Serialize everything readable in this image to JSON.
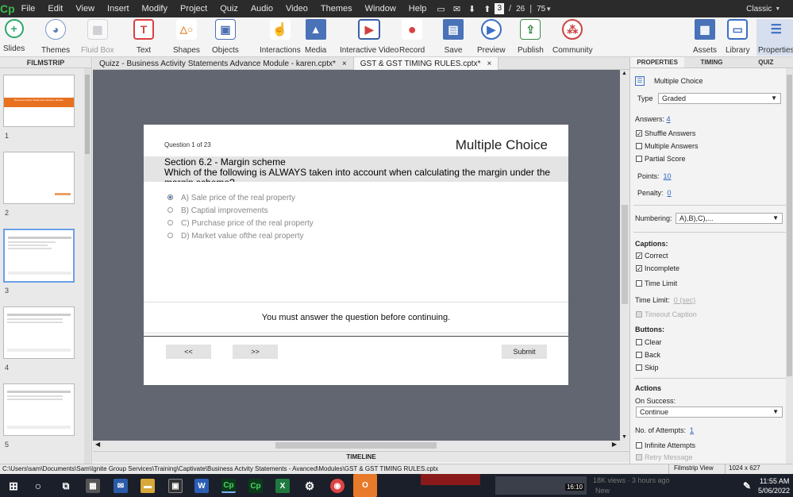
{
  "menubar": {
    "logo": "Cp",
    "items": [
      "File",
      "Edit",
      "View",
      "Insert",
      "Modify",
      "Project",
      "Quiz",
      "Audio",
      "Video",
      "Themes",
      "Window",
      "Help"
    ],
    "current_slide": "3",
    "slide_separator": "/",
    "total_slides": "26",
    "zoom": "75",
    "workspace": "Classic"
  },
  "toolbar": {
    "left_buttons": [
      {
        "label": "Slides",
        "icon": "plus-icon"
      },
      {
        "label": "Themes",
        "icon": "palette-icon"
      },
      {
        "label": "Fluid Box",
        "icon": "fluid-box-icon"
      },
      {
        "label": "Text",
        "icon": "text-icon"
      },
      {
        "label": "Shapes",
        "icon": "shapes-icon"
      },
      {
        "label": "Objects",
        "icon": "objects-icon"
      },
      {
        "label": "Interactions",
        "icon": "hand-icon"
      },
      {
        "label": "Media",
        "icon": "image-icon"
      },
      {
        "label": "Interactive Video",
        "icon": "video-icon"
      },
      {
        "label": "Record",
        "icon": "microphone-icon"
      },
      {
        "label": "Save",
        "icon": "save-icon"
      },
      {
        "label": "Preview",
        "icon": "play-icon"
      },
      {
        "label": "Publish",
        "icon": "publish-icon"
      },
      {
        "label": "Community",
        "icon": "community-icon"
      }
    ],
    "right_buttons": [
      {
        "label": "Assets",
        "icon": "assets-icon"
      },
      {
        "label": "Library",
        "icon": "library-icon"
      },
      {
        "label": "Properties",
        "icon": "properties-icon"
      }
    ]
  },
  "filmstrip": {
    "title": "FILMSTRIP",
    "slide_numbers": [
      "1",
      "2",
      "3",
      "4",
      "5"
    ],
    "slide1_title": "Business Activity Statements Advance Module"
  },
  "doc_tabs": [
    {
      "label": "Quizz - Business Activity Statements Advance Module - karen.cptx*",
      "close": "×"
    },
    {
      "label": "GST & GST TIMING RULES.cptx*",
      "close": "×"
    }
  ],
  "slide": {
    "question_counter": "Question 1 of 23",
    "question_type": "Multiple Choice",
    "section_title": "Section 6.2 - Margin scheme",
    "question_text": "Which of the following is ALWAYS taken into account when calculating the margin under the margin scheme?",
    "answers": [
      "A) Sale price of the real property",
      "B) Captial improvements",
      "C) Purchase price of the real property",
      "D) Market value ofthe real property"
    ],
    "incomplete_caption": "You must answer the question before continuing.",
    "back_button": "<<",
    "next_button": ">>",
    "submit_button": "Submit"
  },
  "properties": {
    "tabs": [
      "PROPERTIES",
      "TIMING",
      "QUIZ"
    ],
    "object_name": "Multiple Choice",
    "type_label": "Type",
    "type_value": "Graded",
    "answers_label": "Answers:",
    "answers_value": "4",
    "shuffle_answers": "Shuffle Answers",
    "multiple_answers": "Multiple Answers",
    "partial_score": "Partial Score",
    "points_label": "Points:",
    "points_value": "10",
    "penalty_label": "Penalty:",
    "penalty_value": "0",
    "numbering_label": "Numbering:",
    "numbering_value": "A),B),C),...",
    "captions_header": "Captions:",
    "correct": "Correct",
    "incomplete": "Incomplete",
    "time_limit": "Time Limit",
    "time_limit_label": "Time Limit:",
    "time_limit_value": "0 (sec)",
    "timeout_caption": "Timeout Caption",
    "buttons_header": "Buttons:",
    "clear": "Clear",
    "back": "Back",
    "skip": "Skip",
    "actions_header": "Actions",
    "on_success_label": "On Success:",
    "on_success_value": "Continue",
    "attempts_label": "No. of Attempts:",
    "attempts_value": "1",
    "infinite_attempts": "Infinite Attempts",
    "retry_message": "Retry Message"
  },
  "timeline": {
    "label": "TIMELINE"
  },
  "statusbar": {
    "path": "C:\\Users\\sam\\Documents\\Sam\\Ignite Group Services\\Training\\Captivate\\Business Actvity Statements - Avanced\\Modules\\GST & GST TIMING RULES.cptx",
    "view": "Filmstrip View",
    "size": "1024 x 627"
  },
  "taskbar": {
    "time": "11:55 AM",
    "date": "5/06/2022",
    "bg_text_1": "18K views · 3 hours ago",
    "bg_text_2": "New",
    "bg_text_3": "16:10"
  }
}
